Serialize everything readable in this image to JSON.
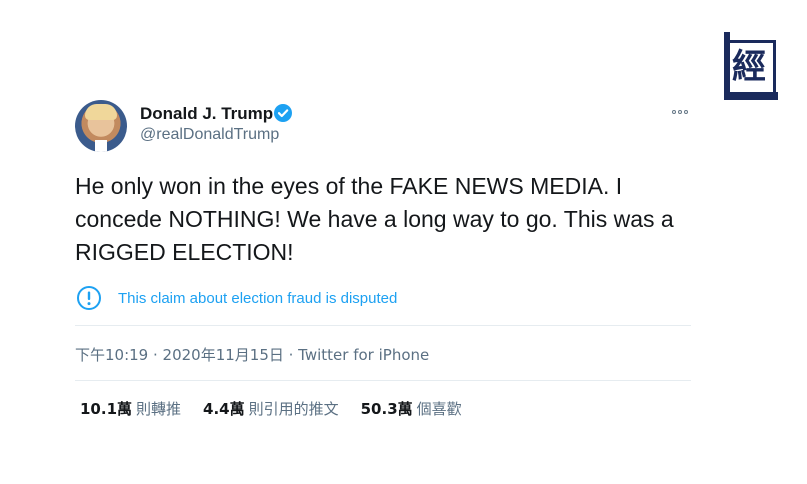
{
  "logo": {
    "glyph": "經"
  },
  "tweet": {
    "author_name": "Donald J. Trump",
    "author_handle": "@realDonaldTrump",
    "text": "He only won in the eyes of the FAKE NEWS MEDIA. I concede NOTHING! We have a long way to go. This was a RIGGED ELECTION!",
    "warning": "This claim about election fraud is disputed",
    "meta": "下午10:19 · 2020年11月15日 · Twitter for iPhone",
    "stats": [
      {
        "value": "10.1萬",
        "label": "則轉推"
      },
      {
        "value": "4.4萬",
        "label": "則引用的推文"
      },
      {
        "value": "50.3萬",
        "label": "個喜歡"
      }
    ]
  },
  "colors": {
    "link_blue": "#1da1f2",
    "text": "#14171a",
    "muted": "#5b7083",
    "divider": "#e6ecf0",
    "logo_navy": "#1a2a5c"
  },
  "icons": {
    "verified": "verified-badge-icon",
    "more": "more-options-icon",
    "warning": "exclamation-circle-icon"
  }
}
